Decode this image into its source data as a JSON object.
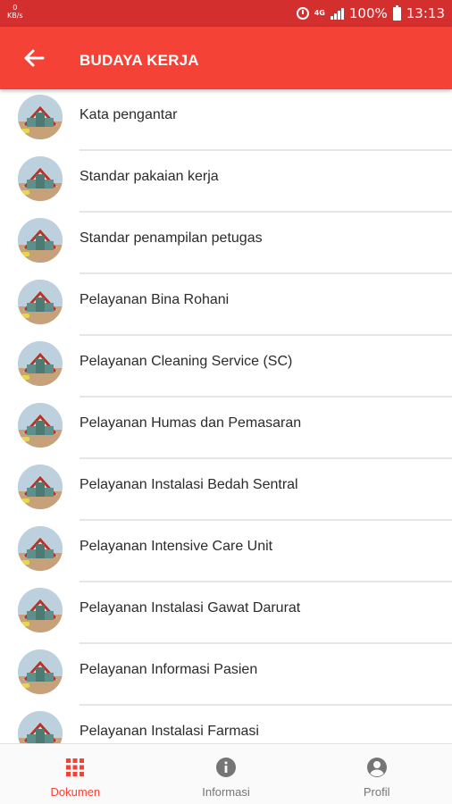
{
  "status_bar": {
    "speed_value": "0",
    "speed_unit": "KB/s",
    "network": "4G",
    "battery": "100%",
    "time": "13:13"
  },
  "app_bar": {
    "title": "BUDAYA KERJA",
    "back_icon": "arrow-left-icon"
  },
  "list": {
    "items": [
      {
        "label": "Kata pengantar"
      },
      {
        "label": "Standar pakaian kerja"
      },
      {
        "label": "Standar penampilan petugas"
      },
      {
        "label": "Pelayanan Bina Rohani"
      },
      {
        "label": "Pelayanan Cleaning Service (SC)"
      },
      {
        "label": "Pelayanan Humas dan Pemasaran"
      },
      {
        "label": "Pelayanan Instalasi Bedah Sentral"
      },
      {
        "label": "Pelayanan Intensive Care Unit"
      },
      {
        "label": "Pelayanan Instalasi Gawat Darurat"
      },
      {
        "label": "Pelayanan Informasi Pasien"
      },
      {
        "label": "Pelayanan Instalasi Farmasi"
      }
    ]
  },
  "bottom_nav": {
    "items": [
      {
        "label": "Dokumen",
        "icon": "grid-icon",
        "active": true
      },
      {
        "label": "Informasi",
        "icon": "info-icon",
        "active": false
      },
      {
        "label": "Profil",
        "icon": "account-circle-icon",
        "active": false
      }
    ]
  },
  "colors": {
    "status_bar": "#d32f2f",
    "app_bar": "#f44336",
    "accent": "#f44336",
    "nav_inactive": "#757575"
  }
}
